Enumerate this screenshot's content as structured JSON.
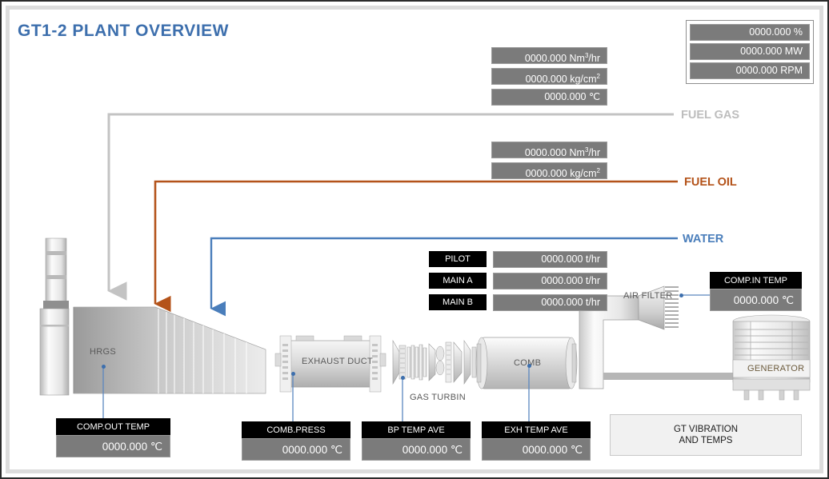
{
  "page_title": "GT1-2 PLANT OVERVIEW",
  "colors": {
    "title": "#3d6fad",
    "fuel_gas": "#c3c3c3",
    "fuel_oil": "#b4531a",
    "water": "#4a7ebb",
    "value_box": "#7b7b7b",
    "caption": "#000000"
  },
  "status_panel": {
    "rows": [
      {
        "value": "0000.000 %"
      },
      {
        "value": "0000.000 MW"
      },
      {
        "value": "0000.000 RPM"
      }
    ]
  },
  "fuel_gas": {
    "label": "FUEL GAS",
    "rows": [
      {
        "value": "0000.000 Nm",
        "sup": "3",
        "unit": "/hr"
      },
      {
        "value": "0000.000 kg/cm",
        "sup": "2",
        "unit": ""
      },
      {
        "value": "0000.000 ℃",
        "sup": "",
        "unit": ""
      }
    ]
  },
  "fuel_oil": {
    "label": "FUEL OIL",
    "rows": [
      {
        "value": "0000.000 Nm",
        "sup": "3",
        "unit": "/hr"
      },
      {
        "value": "0000.000 kg/cm",
        "sup": "2",
        "unit": ""
      }
    ]
  },
  "water": {
    "label": "WATER"
  },
  "burner_table": {
    "rows": [
      {
        "name": "PILOT",
        "value": "0000.000 t/hr"
      },
      {
        "name": "MAIN A",
        "value": "0000.000 t/hr"
      },
      {
        "name": "MAIN B",
        "value": "0000.000 t/hr"
      }
    ]
  },
  "meters": {
    "comp_in_temp": {
      "caption": "COMP.IN TEMP",
      "value": "0000.000 ℃"
    },
    "comp_out_temp": {
      "caption": "COMP.OUT TEMP",
      "value": "0000.000 ℃"
    },
    "comb_press": {
      "caption": "COMB.PRESS",
      "value": "0000.000 ℃"
    },
    "bp_temp_ave": {
      "caption": "BP TEMP AVE",
      "value": "0000.000 ℃"
    },
    "exh_temp_ave": {
      "caption": "EXH TEMP AVE",
      "value": "0000.000 ℃"
    }
  },
  "equipment": {
    "hrgs": "HRGS",
    "exhaust_duct": "EXHAUST DUCT",
    "gas_turbine": "GAS TURBIN",
    "comb": "COMB",
    "air_filter": "AIR FILTER",
    "generator": "GENERATOR"
  },
  "vibration_button": {
    "label": "GT VIBRATION\nAND TEMPS"
  }
}
